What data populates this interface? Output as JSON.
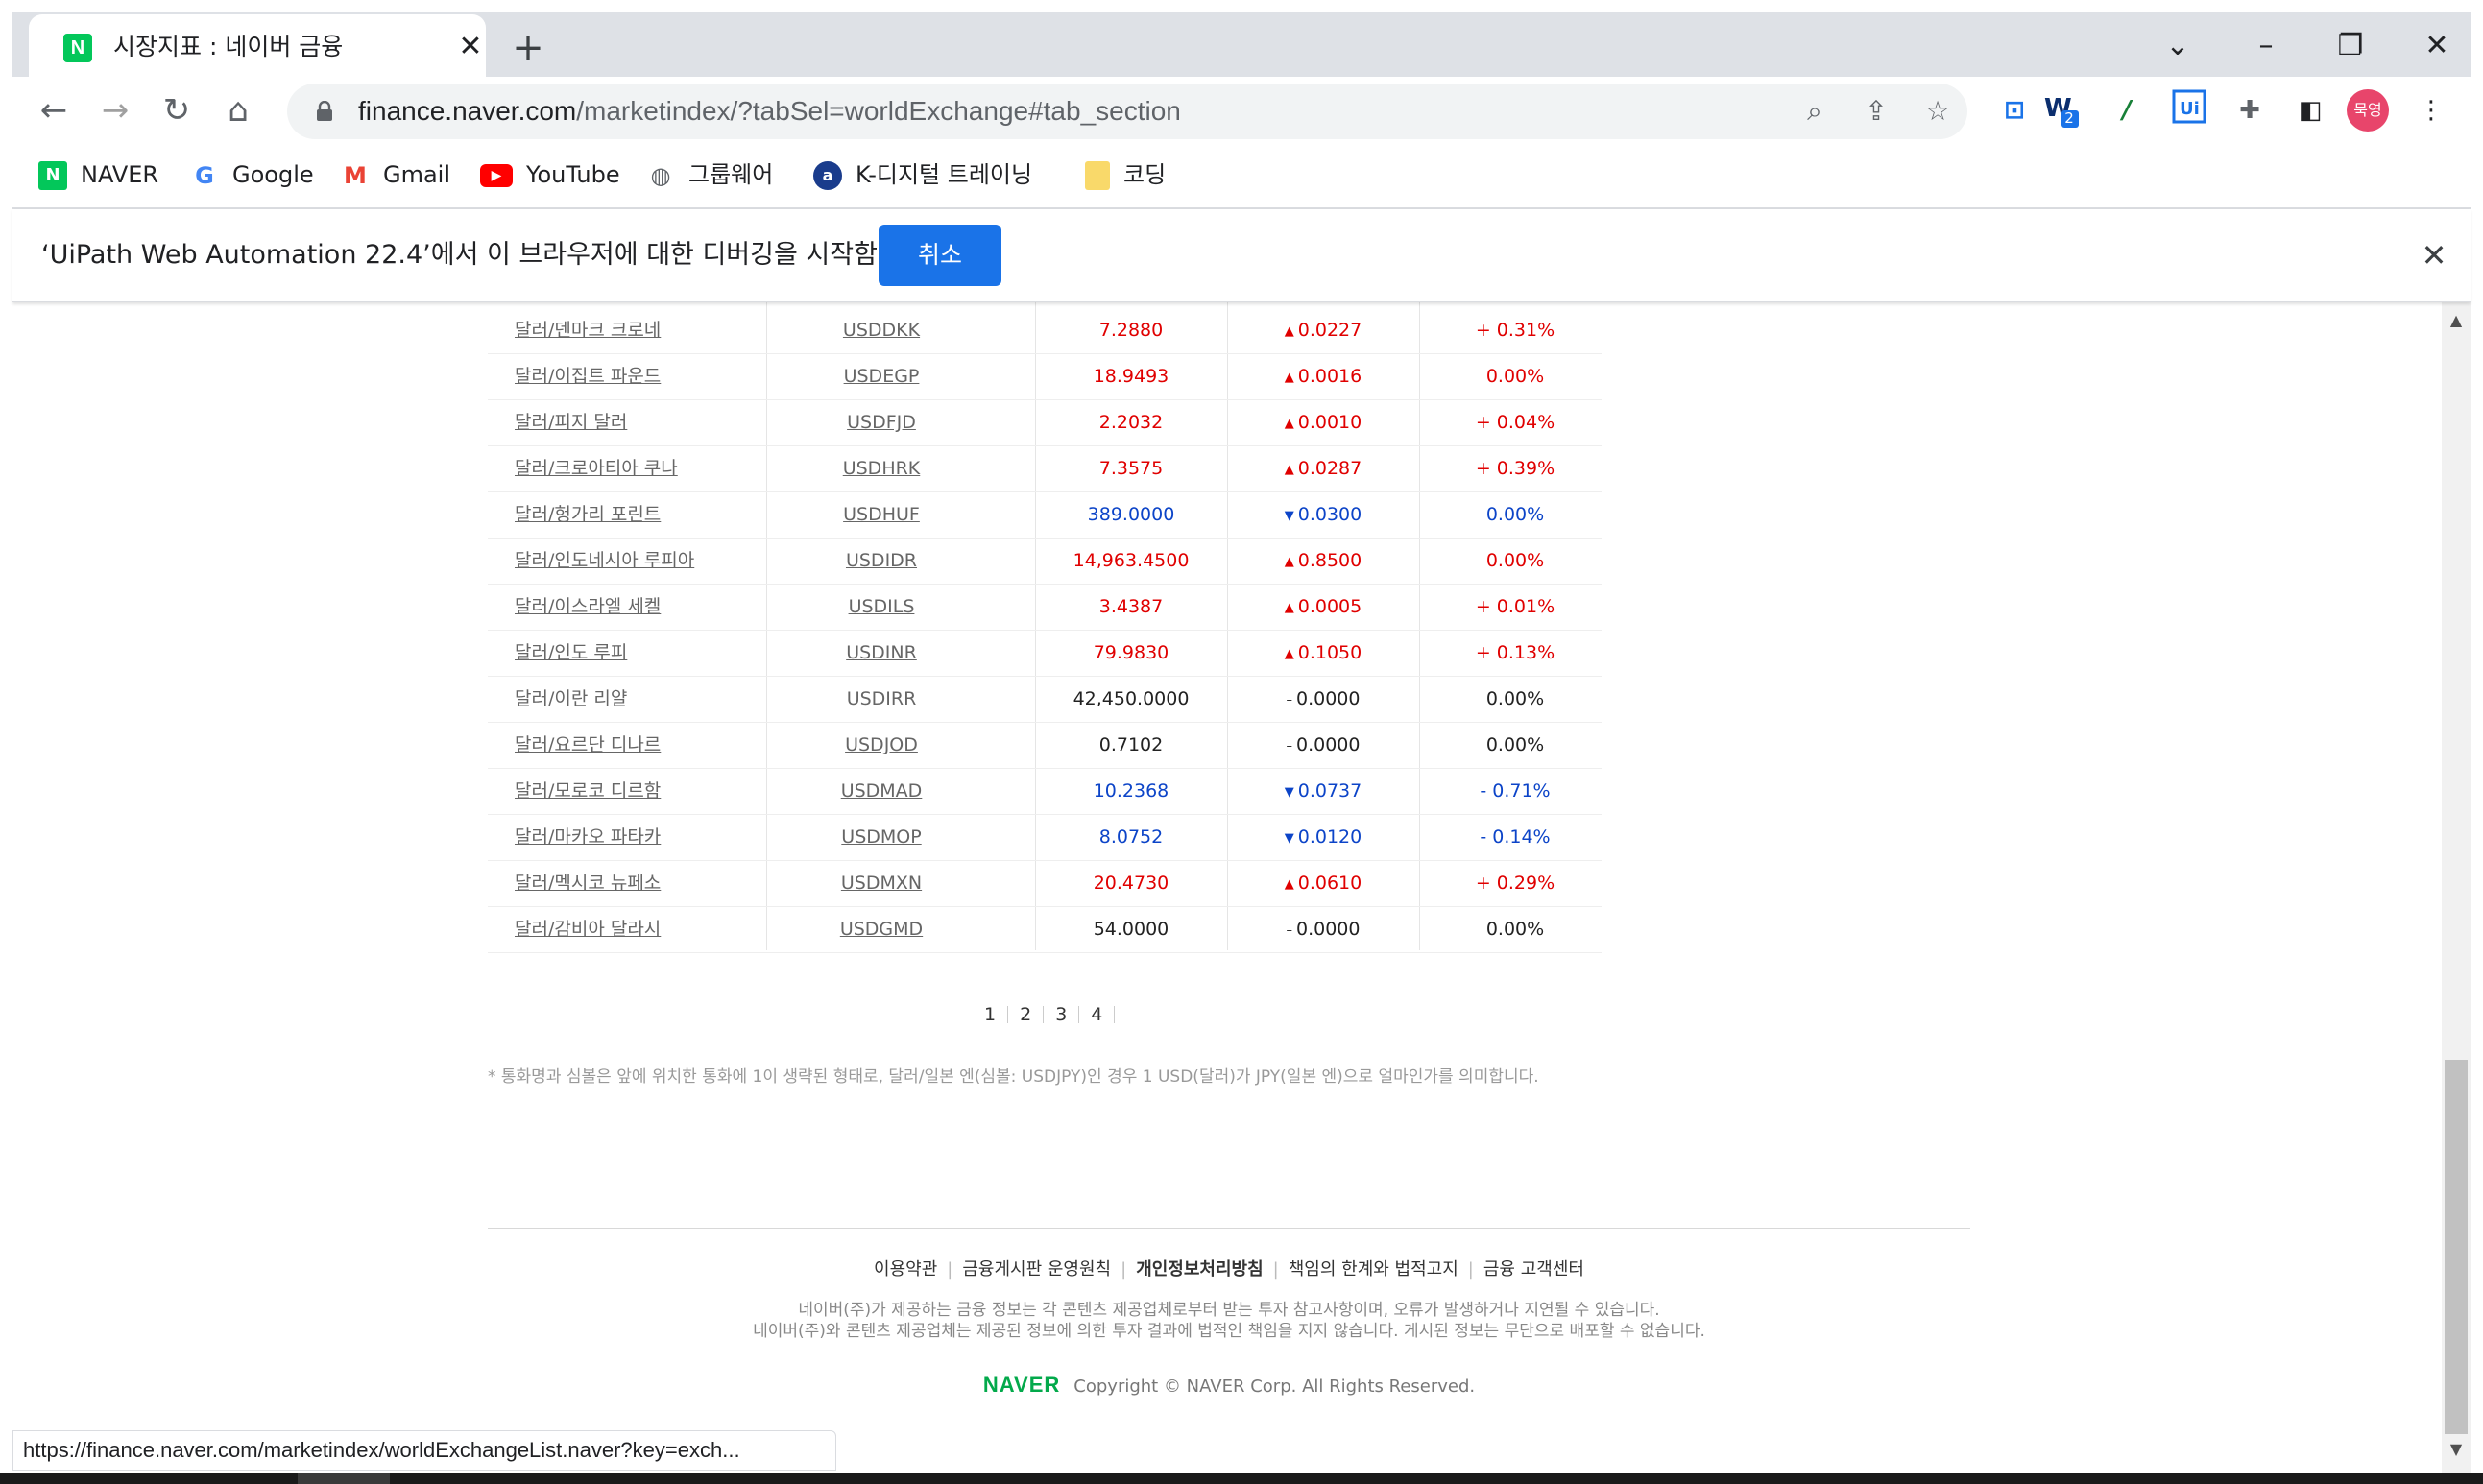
{
  "browser": {
    "tab_title": "시장지표 : 네이버 금융",
    "tab_favicon": "N",
    "url_domain": "finance.naver.com",
    "url_path": "/marketindex/?tabSel=worldExchange#tab_section",
    "profile_label": "묵영",
    "ext_badge": "2"
  },
  "bookmarks": [
    {
      "label": "NAVER",
      "icon": "naver-icon"
    },
    {
      "label": "Google",
      "icon": "google-icon"
    },
    {
      "label": "Gmail",
      "icon": "gmail-icon"
    },
    {
      "label": "YouTube",
      "icon": "youtube-icon"
    },
    {
      "label": "그룹웨어",
      "icon": "globe-icon"
    },
    {
      "label": "K-디지털 트레이닝",
      "icon": "k-digital-icon"
    },
    {
      "label": "코딩",
      "icon": "folder-icon"
    }
  ],
  "infobar": {
    "message": "‘UiPath Web Automation 22.4’에서 이 브라우저에 대한 디버깅을 시작함",
    "cancel_label": "취소"
  },
  "rates": [
    {
      "name": "달러/덴마크 크로네",
      "code": "USDDKK",
      "price": "7.2880",
      "change": "0.0227",
      "pct": "+ 0.31%",
      "dir": "up"
    },
    {
      "name": "달러/이집트 파운드",
      "code": "USDEGP",
      "price": "18.9493",
      "change": "0.0016",
      "pct": "0.00%",
      "dir": "up"
    },
    {
      "name": "달러/피지 달러",
      "code": "USDFJD",
      "price": "2.2032",
      "change": "0.0010",
      "pct": "+ 0.04%",
      "dir": "up"
    },
    {
      "name": "달러/크로아티아 쿠나",
      "code": "USDHRK",
      "price": "7.3575",
      "change": "0.0287",
      "pct": "+ 0.39%",
      "dir": "up"
    },
    {
      "name": "달러/헝가리 포린트",
      "code": "USDHUF",
      "price": "389.0000",
      "change": "0.0300",
      "pct": "0.00%",
      "dir": "down"
    },
    {
      "name": "달러/인도네시아 루피아",
      "code": "USDIDR",
      "price": "14,963.4500",
      "change": "0.8500",
      "pct": "0.00%",
      "dir": "up"
    },
    {
      "name": "달러/이스라엘 세켈",
      "code": "USDILS",
      "price": "3.4387",
      "change": "0.0005",
      "pct": "+ 0.01%",
      "dir": "up"
    },
    {
      "name": "달러/인도 루피",
      "code": "USDINR",
      "price": "79.9830",
      "change": "0.1050",
      "pct": "+ 0.13%",
      "dir": "up"
    },
    {
      "name": "달러/이란 리얄",
      "code": "USDIRR",
      "price": "42,450.0000",
      "change": "0.0000",
      "pct": "0.00%",
      "dir": "flat"
    },
    {
      "name": "달러/요르단 디나르",
      "code": "USDJOD",
      "price": "0.7102",
      "change": "0.0000",
      "pct": "0.00%",
      "dir": "flat"
    },
    {
      "name": "달러/모로코 디르함",
      "code": "USDMAD",
      "price": "10.2368",
      "change": "0.0737",
      "pct": "- 0.71%",
      "dir": "down"
    },
    {
      "name": "달러/마카오 파타카",
      "code": "USDMOP",
      "price": "8.0752",
      "change": "0.0120",
      "pct": "- 0.14%",
      "dir": "down"
    },
    {
      "name": "달러/멕시코 뉴페소",
      "code": "USDMXN",
      "price": "20.4730",
      "change": "0.0610",
      "pct": "+ 0.29%",
      "dir": "up"
    },
    {
      "name": "달러/감비아 달라시",
      "code": "USDGMD",
      "price": "54.0000",
      "change": "0.0000",
      "pct": "0.00%",
      "dir": "flat"
    }
  ],
  "pagination": [
    "1",
    "2",
    "3",
    "4"
  ],
  "note": "* 통화명과 심볼은 앞에 위치한 통화에 1이 생략된 형태로, 달러/일본 엔(심볼: USDJPY)인 경우 1 USD(달러)가 JPY(일본 엔)으로 얼마인가를 의미합니다.",
  "footer": {
    "links": [
      "이용약관",
      "금융게시판 운영원칙",
      "개인정보처리방침",
      "책임의 한계와 법적고지",
      "금융 고객센터"
    ],
    "disclaimer_1": "네이버(주)가 제공하는 금융 정보는 각 콘텐츠 제공업체로부터 받는 투자 참고사항이며, 오류가 발생하거나 지연될 수 있습니다.",
    "disclaimer_2": "네이버(주)와 콘텐츠 제공업체는 제공된 정보에 의한 투자 결과에 법적인 책임을 지지 않습니다. 게시된 정보는 무단으로 배포할 수 없습니다.",
    "logo": "NAVER",
    "copyright": "Copyright © NAVER Corp.  All Rights Reserved."
  },
  "status_bar": "https://finance.naver.com/marketindex/worldExchangeList.naver?key=exch...",
  "colors": {
    "up": "#e00000",
    "down": "#0c44c8",
    "naver_green": "#03c75a",
    "accent": "#1a73e8"
  }
}
